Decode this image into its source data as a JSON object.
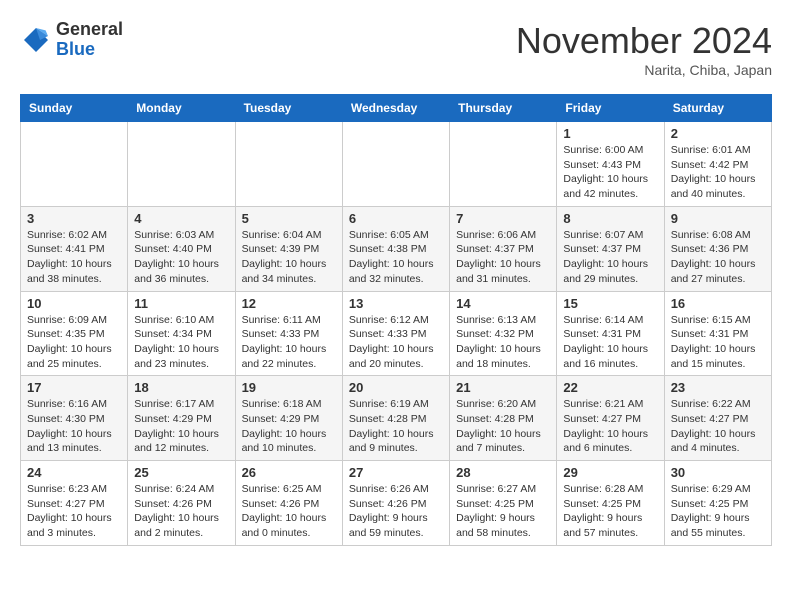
{
  "header": {
    "logo_general": "General",
    "logo_blue": "Blue",
    "month": "November 2024",
    "location": "Narita, Chiba, Japan"
  },
  "weekdays": [
    "Sunday",
    "Monday",
    "Tuesday",
    "Wednesday",
    "Thursday",
    "Friday",
    "Saturday"
  ],
  "weeks": [
    [
      {
        "day": "",
        "info": ""
      },
      {
        "day": "",
        "info": ""
      },
      {
        "day": "",
        "info": ""
      },
      {
        "day": "",
        "info": ""
      },
      {
        "day": "",
        "info": ""
      },
      {
        "day": "1",
        "info": "Sunrise: 6:00 AM\nSunset: 4:43 PM\nDaylight: 10 hours\nand 42 minutes."
      },
      {
        "day": "2",
        "info": "Sunrise: 6:01 AM\nSunset: 4:42 PM\nDaylight: 10 hours\nand 40 minutes."
      }
    ],
    [
      {
        "day": "3",
        "info": "Sunrise: 6:02 AM\nSunset: 4:41 PM\nDaylight: 10 hours\nand 38 minutes."
      },
      {
        "day": "4",
        "info": "Sunrise: 6:03 AM\nSunset: 4:40 PM\nDaylight: 10 hours\nand 36 minutes."
      },
      {
        "day": "5",
        "info": "Sunrise: 6:04 AM\nSunset: 4:39 PM\nDaylight: 10 hours\nand 34 minutes."
      },
      {
        "day": "6",
        "info": "Sunrise: 6:05 AM\nSunset: 4:38 PM\nDaylight: 10 hours\nand 32 minutes."
      },
      {
        "day": "7",
        "info": "Sunrise: 6:06 AM\nSunset: 4:37 PM\nDaylight: 10 hours\nand 31 minutes."
      },
      {
        "day": "8",
        "info": "Sunrise: 6:07 AM\nSunset: 4:37 PM\nDaylight: 10 hours\nand 29 minutes."
      },
      {
        "day": "9",
        "info": "Sunrise: 6:08 AM\nSunset: 4:36 PM\nDaylight: 10 hours\nand 27 minutes."
      }
    ],
    [
      {
        "day": "10",
        "info": "Sunrise: 6:09 AM\nSunset: 4:35 PM\nDaylight: 10 hours\nand 25 minutes."
      },
      {
        "day": "11",
        "info": "Sunrise: 6:10 AM\nSunset: 4:34 PM\nDaylight: 10 hours\nand 23 minutes."
      },
      {
        "day": "12",
        "info": "Sunrise: 6:11 AM\nSunset: 4:33 PM\nDaylight: 10 hours\nand 22 minutes."
      },
      {
        "day": "13",
        "info": "Sunrise: 6:12 AM\nSunset: 4:33 PM\nDaylight: 10 hours\nand 20 minutes."
      },
      {
        "day": "14",
        "info": "Sunrise: 6:13 AM\nSunset: 4:32 PM\nDaylight: 10 hours\nand 18 minutes."
      },
      {
        "day": "15",
        "info": "Sunrise: 6:14 AM\nSunset: 4:31 PM\nDaylight: 10 hours\nand 16 minutes."
      },
      {
        "day": "16",
        "info": "Sunrise: 6:15 AM\nSunset: 4:31 PM\nDaylight: 10 hours\nand 15 minutes."
      }
    ],
    [
      {
        "day": "17",
        "info": "Sunrise: 6:16 AM\nSunset: 4:30 PM\nDaylight: 10 hours\nand 13 minutes."
      },
      {
        "day": "18",
        "info": "Sunrise: 6:17 AM\nSunset: 4:29 PM\nDaylight: 10 hours\nand 12 minutes."
      },
      {
        "day": "19",
        "info": "Sunrise: 6:18 AM\nSunset: 4:29 PM\nDaylight: 10 hours\nand 10 minutes."
      },
      {
        "day": "20",
        "info": "Sunrise: 6:19 AM\nSunset: 4:28 PM\nDaylight: 10 hours\nand 9 minutes."
      },
      {
        "day": "21",
        "info": "Sunrise: 6:20 AM\nSunset: 4:28 PM\nDaylight: 10 hours\nand 7 minutes."
      },
      {
        "day": "22",
        "info": "Sunrise: 6:21 AM\nSunset: 4:27 PM\nDaylight: 10 hours\nand 6 minutes."
      },
      {
        "day": "23",
        "info": "Sunrise: 6:22 AM\nSunset: 4:27 PM\nDaylight: 10 hours\nand 4 minutes."
      }
    ],
    [
      {
        "day": "24",
        "info": "Sunrise: 6:23 AM\nSunset: 4:27 PM\nDaylight: 10 hours\nand 3 minutes."
      },
      {
        "day": "25",
        "info": "Sunrise: 6:24 AM\nSunset: 4:26 PM\nDaylight: 10 hours\nand 2 minutes."
      },
      {
        "day": "26",
        "info": "Sunrise: 6:25 AM\nSunset: 4:26 PM\nDaylight: 10 hours\nand 0 minutes."
      },
      {
        "day": "27",
        "info": "Sunrise: 6:26 AM\nSunset: 4:26 PM\nDaylight: 9 hours\nand 59 minutes."
      },
      {
        "day": "28",
        "info": "Sunrise: 6:27 AM\nSunset: 4:25 PM\nDaylight: 9 hours\nand 58 minutes."
      },
      {
        "day": "29",
        "info": "Sunrise: 6:28 AM\nSunset: 4:25 PM\nDaylight: 9 hours\nand 57 minutes."
      },
      {
        "day": "30",
        "info": "Sunrise: 6:29 AM\nSunset: 4:25 PM\nDaylight: 9 hours\nand 55 minutes."
      }
    ]
  ]
}
